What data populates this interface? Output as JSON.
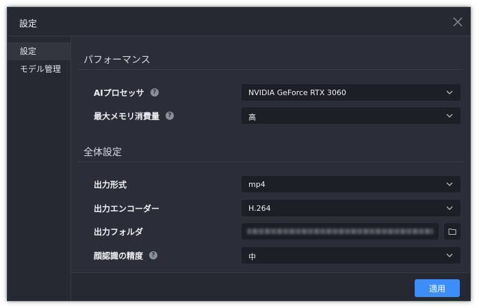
{
  "window": {
    "title": "設定"
  },
  "sidebar": {
    "items": [
      {
        "label": "設定"
      },
      {
        "label": "モデル管理"
      }
    ]
  },
  "performance": {
    "title": "パフォーマンス",
    "ai_processor": {
      "label": "AIプロセッサ",
      "value": "NVIDIA GeForce RTX 3060"
    },
    "max_memory": {
      "label": "最大メモリ消費量",
      "value": "高"
    }
  },
  "general": {
    "title": "全体設定",
    "output_format": {
      "label": "出力形式",
      "value": "mp4"
    },
    "output_encoder": {
      "label": "出力エンコーダー",
      "value": "H.264"
    },
    "output_folder": {
      "label": "出力フォルダ"
    },
    "face_accuracy": {
      "label": "顔認識の精度",
      "value": "中"
    }
  },
  "footer": {
    "apply_label": "適用"
  },
  "colors": {
    "accent": "#3d8ef8",
    "background": "#2b2e38",
    "sidebar": "#262932",
    "field": "#1d1f26"
  },
  "icons": {
    "close": "close-icon",
    "help": "help-icon",
    "chevron": "chevron-down-icon",
    "folder": "folder-icon"
  }
}
